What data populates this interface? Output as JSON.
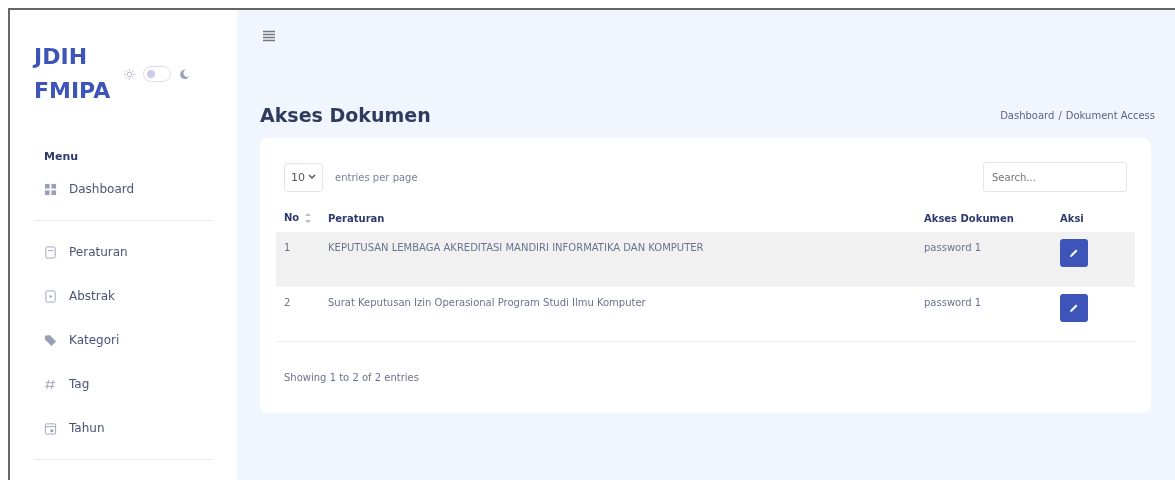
{
  "sidebar": {
    "brand_lines": [
      "JDIH",
      "FMIPA"
    ],
    "dark_mode": false,
    "menu_label": "Menu",
    "groups": [
      [
        {
          "label": "Dashboard",
          "kind": "grid"
        }
      ],
      [
        {
          "label": "Peraturan",
          "kind": "doc"
        },
        {
          "label": "Abstrak",
          "kind": "file"
        },
        {
          "label": "Kategori",
          "kind": "tags"
        },
        {
          "label": "Tag",
          "kind": "hash"
        },
        {
          "label": "Tahun",
          "kind": "calendar"
        }
      ]
    ]
  },
  "page": {
    "title": "Akses Dokumen",
    "breadcrumb": [
      "Dashboard",
      "/",
      "Dokument Access"
    ]
  },
  "table": {
    "page_size": "10",
    "entries_label": "entries per page",
    "search": {
      "placeholder": "Search..."
    },
    "columns": [
      "No",
      "Peraturan",
      "Akses Dokumen",
      "Aksi"
    ],
    "rows": [
      {
        "no": "1",
        "peraturan": "KEPUTUSAN LEMBAGA AKREDITASI MANDIRI INFORMATIKA DAN KOMPUTER",
        "akses": "password 1",
        "highlighted": true
      },
      {
        "no": "2",
        "peraturan": "Surat Keputusan Izin Operasional Program Studi Ilmu Komputer",
        "akses": "password 1",
        "highlighted": false
      }
    ],
    "footer": "Showing 1 to 2 of 2 entries"
  }
}
